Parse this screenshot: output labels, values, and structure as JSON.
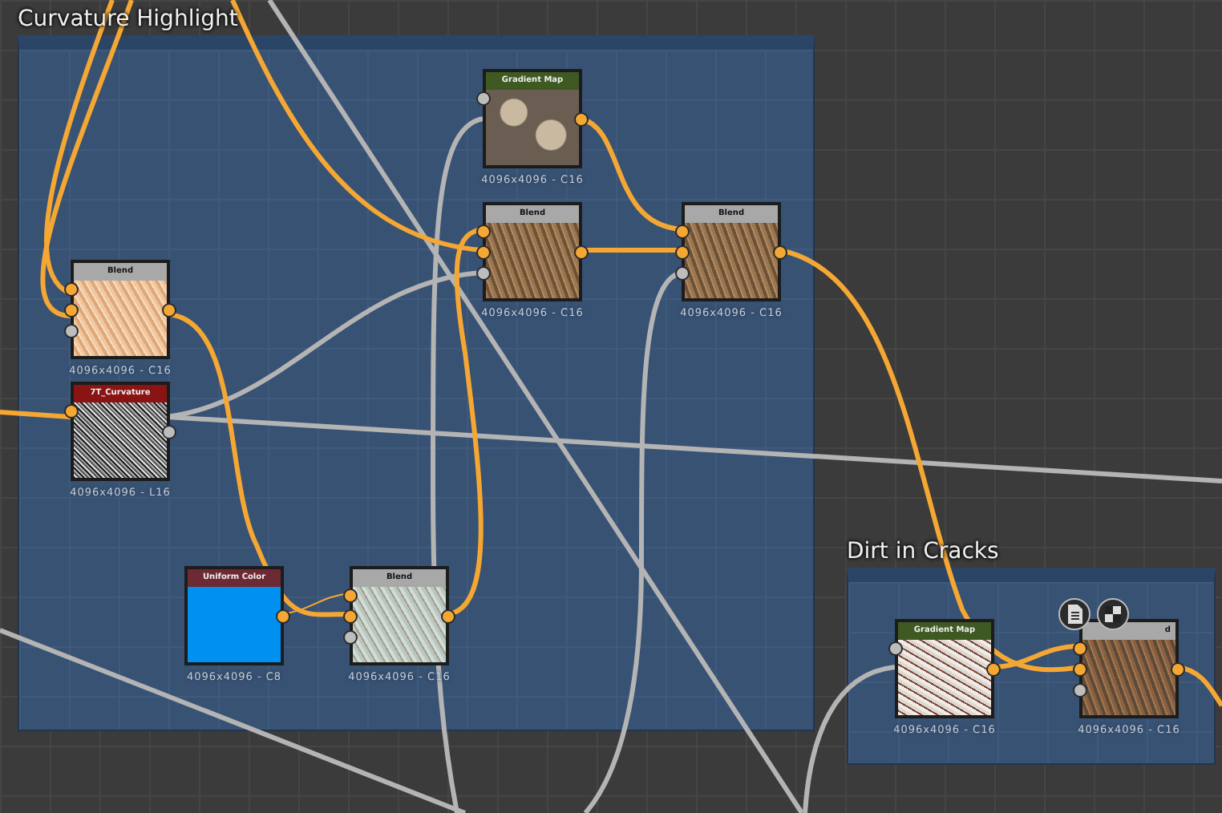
{
  "frames": [
    {
      "title": "Curvature Highlight"
    },
    {
      "title": "Dirt in Cracks"
    }
  ],
  "nodes": [
    {
      "kind": "gradient_map",
      "title": "Gradient Map",
      "resolution": "4096x4096 - C16",
      "inputs": [
        {
          "kind": "gray"
        }
      ],
      "outputs": [
        {
          "kind": "color"
        }
      ]
    },
    {
      "kind": "blend",
      "title": "Blend",
      "resolution": "4096x4096 - C16",
      "inputs": [
        {
          "kind": "color"
        },
        {
          "kind": "color"
        },
        {
          "kind": "gray"
        }
      ],
      "outputs": [
        {
          "kind": "color"
        }
      ]
    },
    {
      "kind": "blend",
      "title": "Blend",
      "resolution": "4096x4096 - C16",
      "inputs": [
        {
          "kind": "color"
        },
        {
          "kind": "color"
        },
        {
          "kind": "gray"
        }
      ],
      "outputs": [
        {
          "kind": "color"
        }
      ]
    },
    {
      "kind": "blend",
      "title": "Blend",
      "resolution": "4096x4096 - C16",
      "inputs": [
        {
          "kind": "color"
        },
        {
          "kind": "color"
        },
        {
          "kind": "gray"
        }
      ],
      "outputs": [
        {
          "kind": "color"
        }
      ]
    },
    {
      "kind": "bitmap",
      "title": "7T_Curvature",
      "resolution": "4096x4096 - L16",
      "inputs": [
        {
          "kind": "color"
        }
      ],
      "outputs": [
        {
          "kind": "gray"
        }
      ]
    },
    {
      "kind": "uniform_color",
      "title": "Uniform Color",
      "resolution": "4096x4096 - C8",
      "outputs": [
        {
          "kind": "color"
        }
      ]
    },
    {
      "kind": "blend",
      "title": "Blend",
      "resolution": "4096x4096 - C16",
      "inputs": [
        {
          "kind": "color"
        },
        {
          "kind": "color"
        },
        {
          "kind": "gray"
        }
      ],
      "outputs": [
        {
          "kind": "color"
        }
      ]
    },
    {
      "kind": "gradient_map",
      "title": "Gradient Map",
      "resolution": "4096x4096 - C16",
      "inputs": [
        {
          "kind": "gray"
        }
      ],
      "outputs": [
        {
          "kind": "color"
        }
      ]
    },
    {
      "kind": "blend",
      "title": "d",
      "resolution": "4096x4096 - C16",
      "inputs": [
        {
          "kind": "color"
        },
        {
          "kind": "color"
        },
        {
          "kind": "gray"
        }
      ],
      "outputs": [
        {
          "kind": "color"
        }
      ],
      "badges": [
        {
          "kind": "document"
        },
        {
          "kind": "checker"
        }
      ]
    }
  ]
}
